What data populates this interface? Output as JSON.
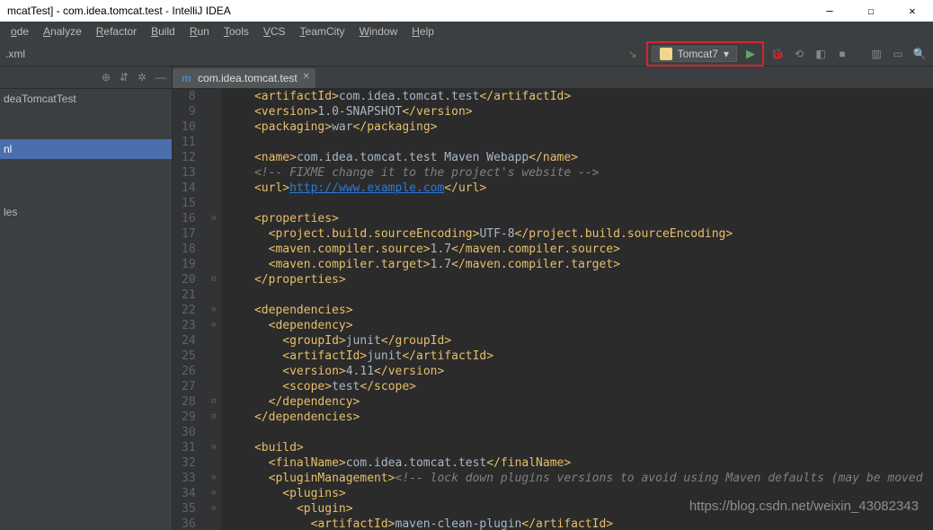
{
  "title": "mcatTest] - com.idea.tomcat.test - IntelliJ IDEA",
  "menus": [
    "ode",
    "Analyze",
    "Refactor",
    "Build",
    "Run",
    "Tools",
    "VCS",
    "TeamCity",
    "Window",
    "Help"
  ],
  "menus_u": [
    "o",
    "A",
    "R",
    "B",
    "R",
    "T",
    "V",
    "T",
    "W",
    "H"
  ],
  "breadcrumb": ".xml",
  "run_config": "Tomcat7",
  "tree": {
    "root": "deaTomcatTest",
    "items": [
      "nl",
      "les"
    ]
  },
  "tab": {
    "icon": "m",
    "label": "com.idea.tomcat.test"
  },
  "lines_start": 8,
  "lines_end": 36,
  "code": [
    {
      "n": 8,
      "f": "",
      "segs": [
        [
          "    ",
          ""
        ],
        [
          "<artifactId>",
          "tag"
        ],
        [
          "com.idea.tomcat.test",
          "txt"
        ],
        [
          "</artifactId>",
          "tag"
        ]
      ]
    },
    {
      "n": 9,
      "f": "",
      "segs": [
        [
          "    ",
          ""
        ],
        [
          "<version>",
          "tag"
        ],
        [
          "1.0-SNAPSHOT",
          "txt"
        ],
        [
          "</version>",
          "tag"
        ]
      ]
    },
    {
      "n": 10,
      "f": "",
      "segs": [
        [
          "    ",
          ""
        ],
        [
          "<packaging>",
          "tag"
        ],
        [
          "war",
          "txt"
        ],
        [
          "</packaging>",
          "tag"
        ]
      ]
    },
    {
      "n": 11,
      "f": "",
      "segs": [
        [
          "",
          ""
        ]
      ]
    },
    {
      "n": 12,
      "f": "",
      "segs": [
        [
          "    ",
          ""
        ],
        [
          "<name>",
          "tag"
        ],
        [
          "com.idea.tomcat.test Maven Webapp",
          "txt"
        ],
        [
          "</name>",
          "tag"
        ]
      ]
    },
    {
      "n": 13,
      "f": "",
      "segs": [
        [
          "    ",
          ""
        ],
        [
          "<!-- ",
          "cmt"
        ],
        [
          "FIXME change it to the project's website",
          "cmt"
        ],
        [
          " -->",
          "cmt"
        ]
      ]
    },
    {
      "n": 14,
      "f": "",
      "segs": [
        [
          "    ",
          ""
        ],
        [
          "<url>",
          "tag"
        ],
        [
          "http://www.example.com",
          "url"
        ],
        [
          "</url>",
          "tag"
        ]
      ]
    },
    {
      "n": 15,
      "f": "",
      "segs": [
        [
          "",
          ""
        ]
      ]
    },
    {
      "n": 16,
      "f": "⊖",
      "segs": [
        [
          "    ",
          ""
        ],
        [
          "<properties>",
          "tag"
        ]
      ]
    },
    {
      "n": 17,
      "f": "",
      "segs": [
        [
          "      ",
          ""
        ],
        [
          "<project.build.sourceEncoding>",
          "tag"
        ],
        [
          "UTF-8",
          "txt"
        ],
        [
          "</project.build.sourceEncoding>",
          "tag"
        ]
      ]
    },
    {
      "n": 18,
      "f": "",
      "segs": [
        [
          "      ",
          ""
        ],
        [
          "<maven.compiler.source>",
          "tag"
        ],
        [
          "1.7",
          "txt"
        ],
        [
          "</maven.compiler.source>",
          "tag"
        ]
      ]
    },
    {
      "n": 19,
      "f": "",
      "segs": [
        [
          "      ",
          ""
        ],
        [
          "<maven.compiler.target>",
          "tag"
        ],
        [
          "1.7",
          "txt"
        ],
        [
          "</maven.compiler.target>",
          "tag"
        ]
      ]
    },
    {
      "n": 20,
      "f": "⊟",
      "segs": [
        [
          "    ",
          ""
        ],
        [
          "</properties>",
          "tag"
        ]
      ]
    },
    {
      "n": 21,
      "f": "",
      "segs": [
        [
          "",
          ""
        ]
      ]
    },
    {
      "n": 22,
      "f": "⊖",
      "segs": [
        [
          "    ",
          ""
        ],
        [
          "<dependencies>",
          "tag"
        ]
      ]
    },
    {
      "n": 23,
      "f": "⊖",
      "segs": [
        [
          "      ",
          ""
        ],
        [
          "<dependency>",
          "tag"
        ]
      ]
    },
    {
      "n": 24,
      "f": "",
      "segs": [
        [
          "        ",
          ""
        ],
        [
          "<groupId>",
          "tag"
        ],
        [
          "junit",
          "txt"
        ],
        [
          "</groupId>",
          "tag"
        ]
      ]
    },
    {
      "n": 25,
      "f": "",
      "segs": [
        [
          "        ",
          ""
        ],
        [
          "<artifactId>",
          "tag"
        ],
        [
          "junit",
          "txt"
        ],
        [
          "</artifactId>",
          "tag"
        ]
      ]
    },
    {
      "n": 26,
      "f": "",
      "segs": [
        [
          "        ",
          ""
        ],
        [
          "<version>",
          "tag"
        ],
        [
          "4.11",
          "txt"
        ],
        [
          "</version>",
          "tag"
        ]
      ]
    },
    {
      "n": 27,
      "f": "",
      "segs": [
        [
          "        ",
          ""
        ],
        [
          "<scope>",
          "tag"
        ],
        [
          "test",
          "txt"
        ],
        [
          "</scope>",
          "tag"
        ]
      ]
    },
    {
      "n": 28,
      "f": "⊟",
      "segs": [
        [
          "      ",
          ""
        ],
        [
          "</dependency>",
          "tag"
        ]
      ]
    },
    {
      "n": 29,
      "f": "⊟",
      "segs": [
        [
          "    ",
          ""
        ],
        [
          "</dependencies>",
          "tag"
        ]
      ]
    },
    {
      "n": 30,
      "f": "",
      "segs": [
        [
          "",
          ""
        ]
      ]
    },
    {
      "n": 31,
      "f": "⊖",
      "segs": [
        [
          "    ",
          ""
        ],
        [
          "<build>",
          "tag"
        ]
      ]
    },
    {
      "n": 32,
      "f": "",
      "segs": [
        [
          "      ",
          ""
        ],
        [
          "<finalName>",
          "tag"
        ],
        [
          "com.idea.tomcat.test",
          "txt"
        ],
        [
          "</finalName>",
          "tag"
        ]
      ]
    },
    {
      "n": 33,
      "f": "⊖",
      "segs": [
        [
          "      ",
          ""
        ],
        [
          "<pluginManagement>",
          "tag"
        ],
        [
          "<!-- lock down plugins versions to avoid using Maven defaults (may be moved",
          "cmt"
        ]
      ]
    },
    {
      "n": 34,
      "f": "⊖",
      "segs": [
        [
          "        ",
          ""
        ],
        [
          "<plugins>",
          "tag"
        ]
      ]
    },
    {
      "n": 35,
      "f": "⊖",
      "segs": [
        [
          "          ",
          ""
        ],
        [
          "<plugin>",
          "tag"
        ]
      ]
    },
    {
      "n": 36,
      "f": "",
      "segs": [
        [
          "            ",
          ""
        ],
        [
          "<artifactId>",
          "tag"
        ],
        [
          "maven-clean-plugin",
          "txt"
        ],
        [
          "</artifactId>",
          "tag"
        ]
      ]
    }
  ],
  "watermark": "https://blog.csdn.net/weixin_43082343"
}
